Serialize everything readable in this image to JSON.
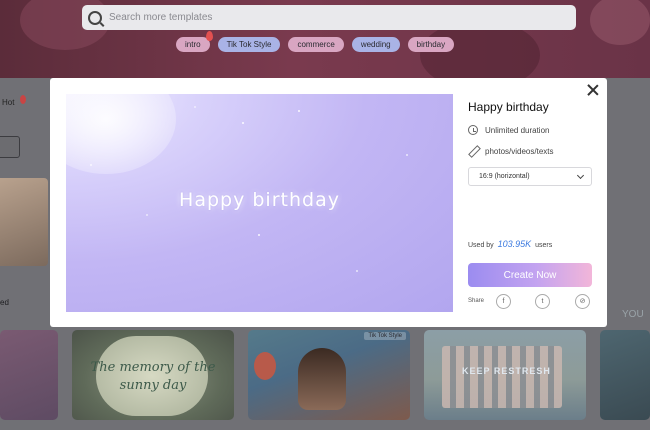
{
  "search": {
    "placeholder": "Search more templates"
  },
  "tags": [
    "intro",
    "Tik Tok Style",
    "commerce",
    "wedding",
    "birthday"
  ],
  "sidebar": {
    "hot_label": "Hot",
    "text_fragment": "ed"
  },
  "cards": {
    "memory_text_line1": "The memory of the",
    "memory_text_line2": "sunny day",
    "tiktok_tag": "Tik Tok Style",
    "group_text": "KEEP RESTRESH",
    "partial_text": "YOU"
  },
  "modal": {
    "preview_title": "Happy birthday",
    "title": "Happy birthday",
    "duration_label": "Unlimited duration",
    "media_label": "photos/videos/texts",
    "aspect_ratio": "16:9 (horizontal)",
    "used_prefix": "Used by",
    "used_count": "103.95K",
    "used_suffix": "users",
    "create_button": "Create Now",
    "share_label": "Share",
    "share_icons": [
      "facebook-icon",
      "twitter-icon",
      "link-icon"
    ]
  },
  "colors": {
    "accent_blue": "#3d7be0",
    "button_gradient_start": "#9b8cf0",
    "button_gradient_end": "#f2b6d9",
    "preview_lavender": "#c2b6f4"
  }
}
